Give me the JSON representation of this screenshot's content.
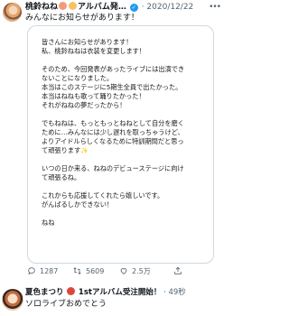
{
  "tweet": {
    "author_name": "桃鈴ねね",
    "author_name_suffix": "アルバム発…",
    "handle_date": "· 2020/12/22",
    "text": "みんなにお知らせがあります！"
  },
  "card": {
    "lines": [
      "皆さんにお知らせがあります！",
      "私、桃鈴ねねは衣装を変更します！",
      "",
      "そのため、今回発表があったライブには出演でき",
      "ないことになりました。",
      "本当はこのステージに5期生全員で出たかった。",
      "本当はねねも歌って踊りたかった！",
      "それがねねの夢だったから！",
      "",
      "でもねねは、もっともっとねねとして自分を磨く",
      "ために…みんなには少し遅れを取っちゃうけど、",
      "よりアイドルらしくなるために特訓期間だと思っ",
      "て頑張ります",
      "",
      "いつの日か来る、ねねのデビューステージに向け",
      "て頑張るね。",
      "",
      "これからも応援してくれたら嬉しいです。",
      "がんばるしかできない！",
      "",
      "ねね"
    ]
  },
  "actions": {
    "replies": "1287",
    "retweets": "5609",
    "likes": "2.5万"
  },
  "reply": {
    "author_name": "夏色まつり",
    "author_name_suffix": "1stアルバム受注開始！",
    "time": "· 49秒",
    "text": "ソロライブおめでとう"
  },
  "colors": {
    "accent": "#1d9bf0",
    "muted": "#536471",
    "border": "#cfd9de"
  },
  "icons": [
    "more-icon",
    "reply-icon",
    "retweet-icon",
    "like-icon",
    "share-icon",
    "verified-badge-icon"
  ]
}
